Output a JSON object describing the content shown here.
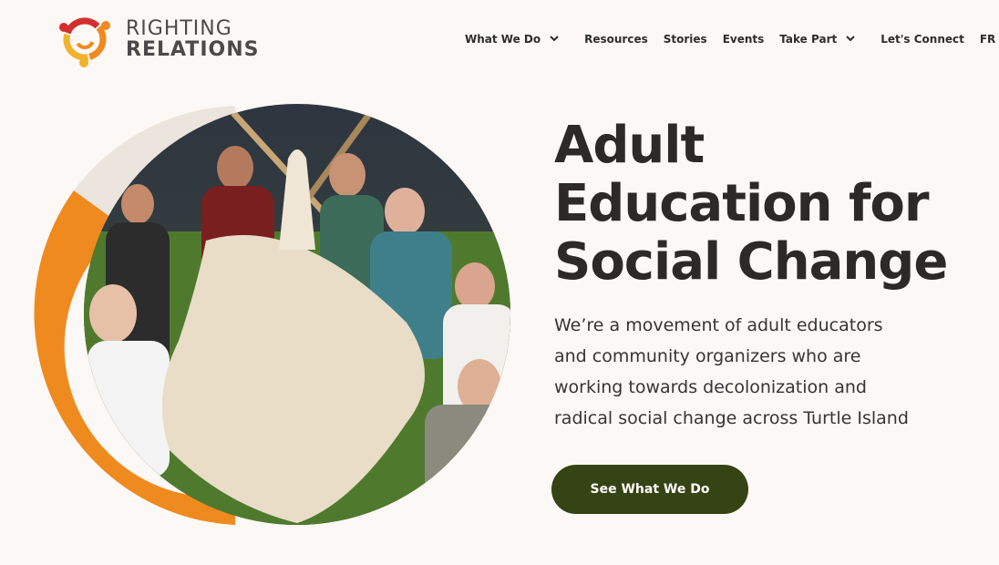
{
  "logo": {
    "line1": "RIGHTING",
    "line2": "RELATIONS"
  },
  "nav": {
    "items": [
      {
        "label": "What We Do",
        "dropdown": true
      },
      {
        "label": "Resources",
        "dropdown": false
      },
      {
        "label": "Stories",
        "dropdown": false
      },
      {
        "label": "Events",
        "dropdown": false
      },
      {
        "label": "Take Part",
        "dropdown": true
      },
      {
        "label": "Let's Connect",
        "dropdown": false
      },
      {
        "label": "FR",
        "dropdown": false
      }
    ]
  },
  "hero": {
    "title_line1": "Adult",
    "title_line2": "Education for",
    "title_line3": "Social Change",
    "subtitle": "We’re a movement of adult educators and community organizers who are working towards decolonization and radical social change across Turtle Island",
    "cta_label": "See What We Do"
  },
  "colors": {
    "background": "#fcf8f5",
    "orange": "#ef8a1f",
    "red": "#d32f2f",
    "yellow": "#f2b22b",
    "cta": "#364314",
    "title": "#2b2a27"
  },
  "icons": {
    "dropdown": "chevron-down-icon",
    "logo": "righting-relations-logo-icon"
  }
}
